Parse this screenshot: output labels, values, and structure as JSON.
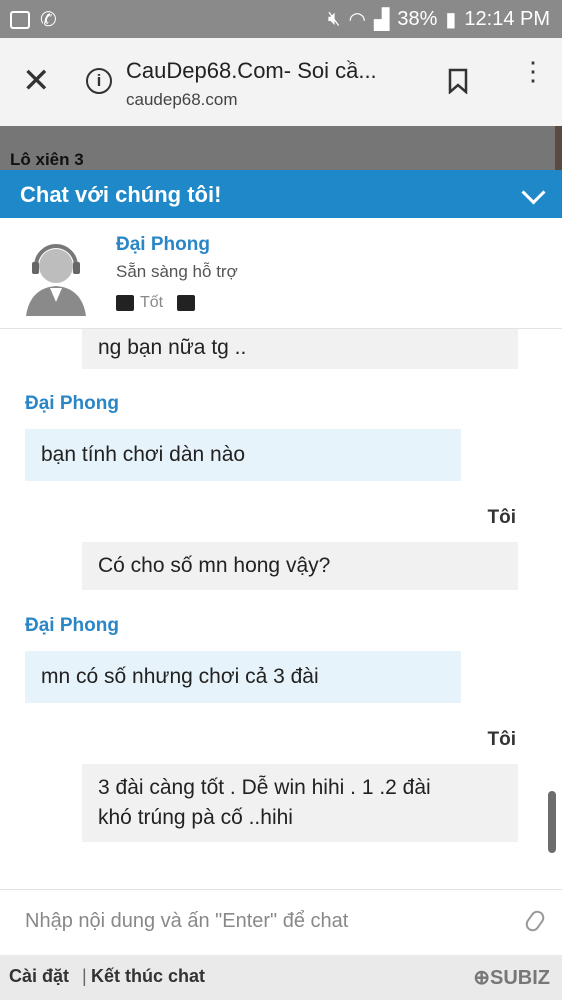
{
  "status_bar": {
    "battery": "38%",
    "time": "12:14 PM"
  },
  "browser": {
    "title": "CauDep68.Com- Soi cầ...",
    "url": "caudep68.com"
  },
  "page_behind": {
    "heading": "Lô xiên 3"
  },
  "chat": {
    "header_title": "Chat với chúng tôi!",
    "agent": {
      "name": "Đại Phong",
      "status": "Sẵn sàng hỗ trợ",
      "rate_good": "Tốt"
    },
    "messages": [
      {
        "from": "me",
        "sender": "",
        "lines": [
          "ng bạn nữa tg .."
        ]
      },
      {
        "from": "agent",
        "sender": "Đại Phong",
        "lines": [
          "bạn tính chơi dàn nào"
        ]
      },
      {
        "from": "me",
        "sender": "Tôi",
        "lines": [
          "Có cho số mn hong vậy?"
        ]
      },
      {
        "from": "agent",
        "sender": "Đại Phong",
        "lines": [
          "mn có số nhưng chơi cả 3 đài"
        ]
      },
      {
        "from": "me",
        "sender": "Tôi",
        "lines": [
          "3 đài càng tốt . Dễ win hihi . 1 .2 đài",
          "khó trúng pà cố ..hihi"
        ]
      }
    ],
    "input_placeholder": "Nhập nội dung và ấn \"Enter\" để chat",
    "footer": {
      "settings": "Cài đặt",
      "separator": "|",
      "end_chat": "Kết thúc chat",
      "brand": "SUBIZ"
    }
  },
  "colors": {
    "accent": "#1e88c8",
    "agent_bubble": "#e6f3fb",
    "my_bubble": "#f1f1f1"
  }
}
